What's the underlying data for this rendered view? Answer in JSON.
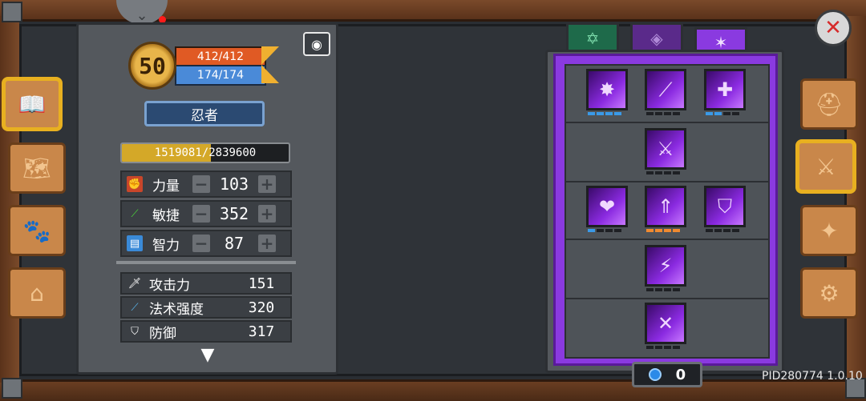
{
  "character": {
    "level": "50",
    "hp": "412/412",
    "mp": "174/174",
    "class_name": "忍者",
    "xp_text": "1519081/2839600",
    "xp_fraction": 0.535
  },
  "attributes": [
    {
      "label": "力量",
      "value": "103",
      "icon": "fist-icon",
      "color": "#c8462a"
    },
    {
      "label": "敏捷",
      "value": "352",
      "icon": "feather-icon",
      "color": "#4aa83a"
    },
    {
      "label": "智力",
      "value": "87",
      "icon": "book-icon",
      "color": "#3a8ad8"
    }
  ],
  "derived": [
    {
      "label": "攻击力",
      "value": "151",
      "icon": "sword-icon"
    },
    {
      "label": "法术强度",
      "value": "320",
      "icon": "wand-icon"
    },
    {
      "label": "防御",
      "value": "317",
      "icon": "shield-icon"
    }
  ],
  "skill_tabs": [
    "star-tab-icon",
    "diamond-tab-icon",
    "ninja-tab-icon"
  ],
  "skill_points": "0",
  "build_id": "PID280774 1.0.10",
  "left_menu": [
    "journal-icon",
    "map-icon",
    "pets-icon",
    "bag-icon"
  ],
  "right_menu": [
    "helmet-icon",
    "skills-icon",
    "compass-icon",
    "settings-icon"
  ]
}
